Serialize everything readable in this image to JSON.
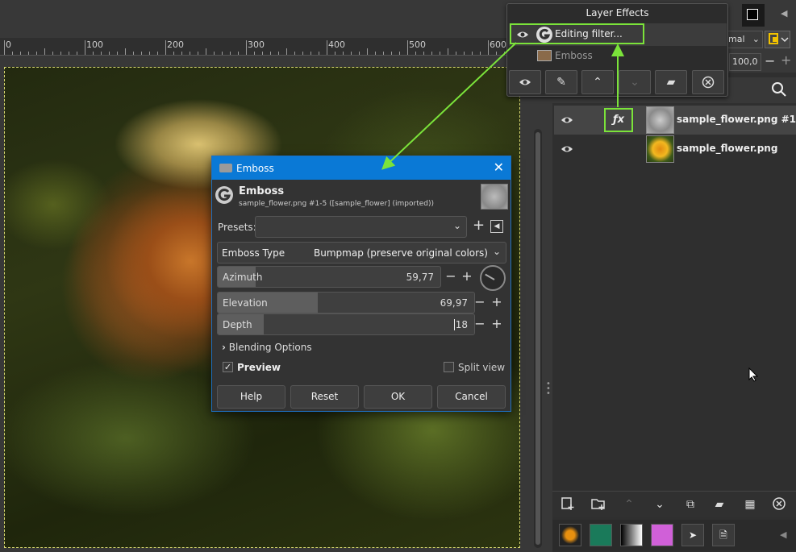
{
  "ruler": {
    "labels": [
      "0",
      "100",
      "200",
      "300",
      "400",
      "500",
      "600"
    ]
  },
  "layer_effects": {
    "title": "Layer Effects",
    "items": [
      {
        "label": "Editing filter...",
        "active": true
      },
      {
        "label": "Emboss",
        "active": false
      }
    ]
  },
  "top_right": {
    "mode_partial": "mal",
    "opacity_value": "100,0"
  },
  "layers": [
    {
      "name": "sample_flower.png #1",
      "has_fx": true,
      "fx_label": "ƒx"
    },
    {
      "name": "sample_flower.png",
      "has_fx": false
    }
  ],
  "dialog": {
    "window_title": "Emboss",
    "filter_name": "Emboss",
    "subtitle": "sample_flower.png #1-5 ([sample_flower] (imported))",
    "presets_label": "Presets:",
    "presets_value": "",
    "emboss_type_label": "Emboss Type",
    "emboss_type_value": "Bumpmap (preserve original colors)",
    "azimuth": {
      "label": "Azimuth",
      "value": "59,77",
      "fraction": 0.17
    },
    "elevation": {
      "label": "Elevation",
      "value": "69,97",
      "fraction": 0.39
    },
    "depth": {
      "label": "Depth",
      "value": "18",
      "fraction": 0.18
    },
    "blending_label": "Blending Options",
    "preview_label": "Preview",
    "preview_checked": true,
    "split_view_label": "Split view",
    "split_view_checked": false,
    "buttons": {
      "help": "Help",
      "reset": "Reset",
      "ok": "OK",
      "cancel": "Cancel"
    }
  },
  "colors": {
    "accent_green": "#7be33a",
    "title_blue": "#0a79d6"
  }
}
